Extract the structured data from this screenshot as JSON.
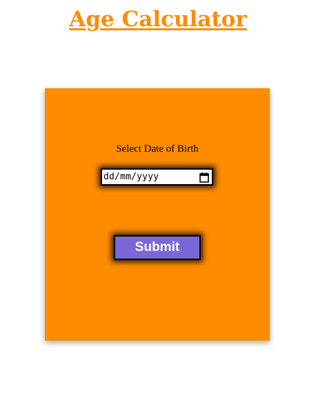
{
  "header": {
    "title": "Age Calculator"
  },
  "form": {
    "dob_label": "Select Date of Birth",
    "date_placeholder": "dd/mm/yyyy",
    "submit_label": "Submit"
  },
  "icons": {
    "date_picker": "calendar-icon"
  },
  "colors": {
    "accent": "#ff8c00",
    "card_background": "#ff8c00",
    "button_background": "#7b68d6",
    "button_text": "#ffffff"
  }
}
